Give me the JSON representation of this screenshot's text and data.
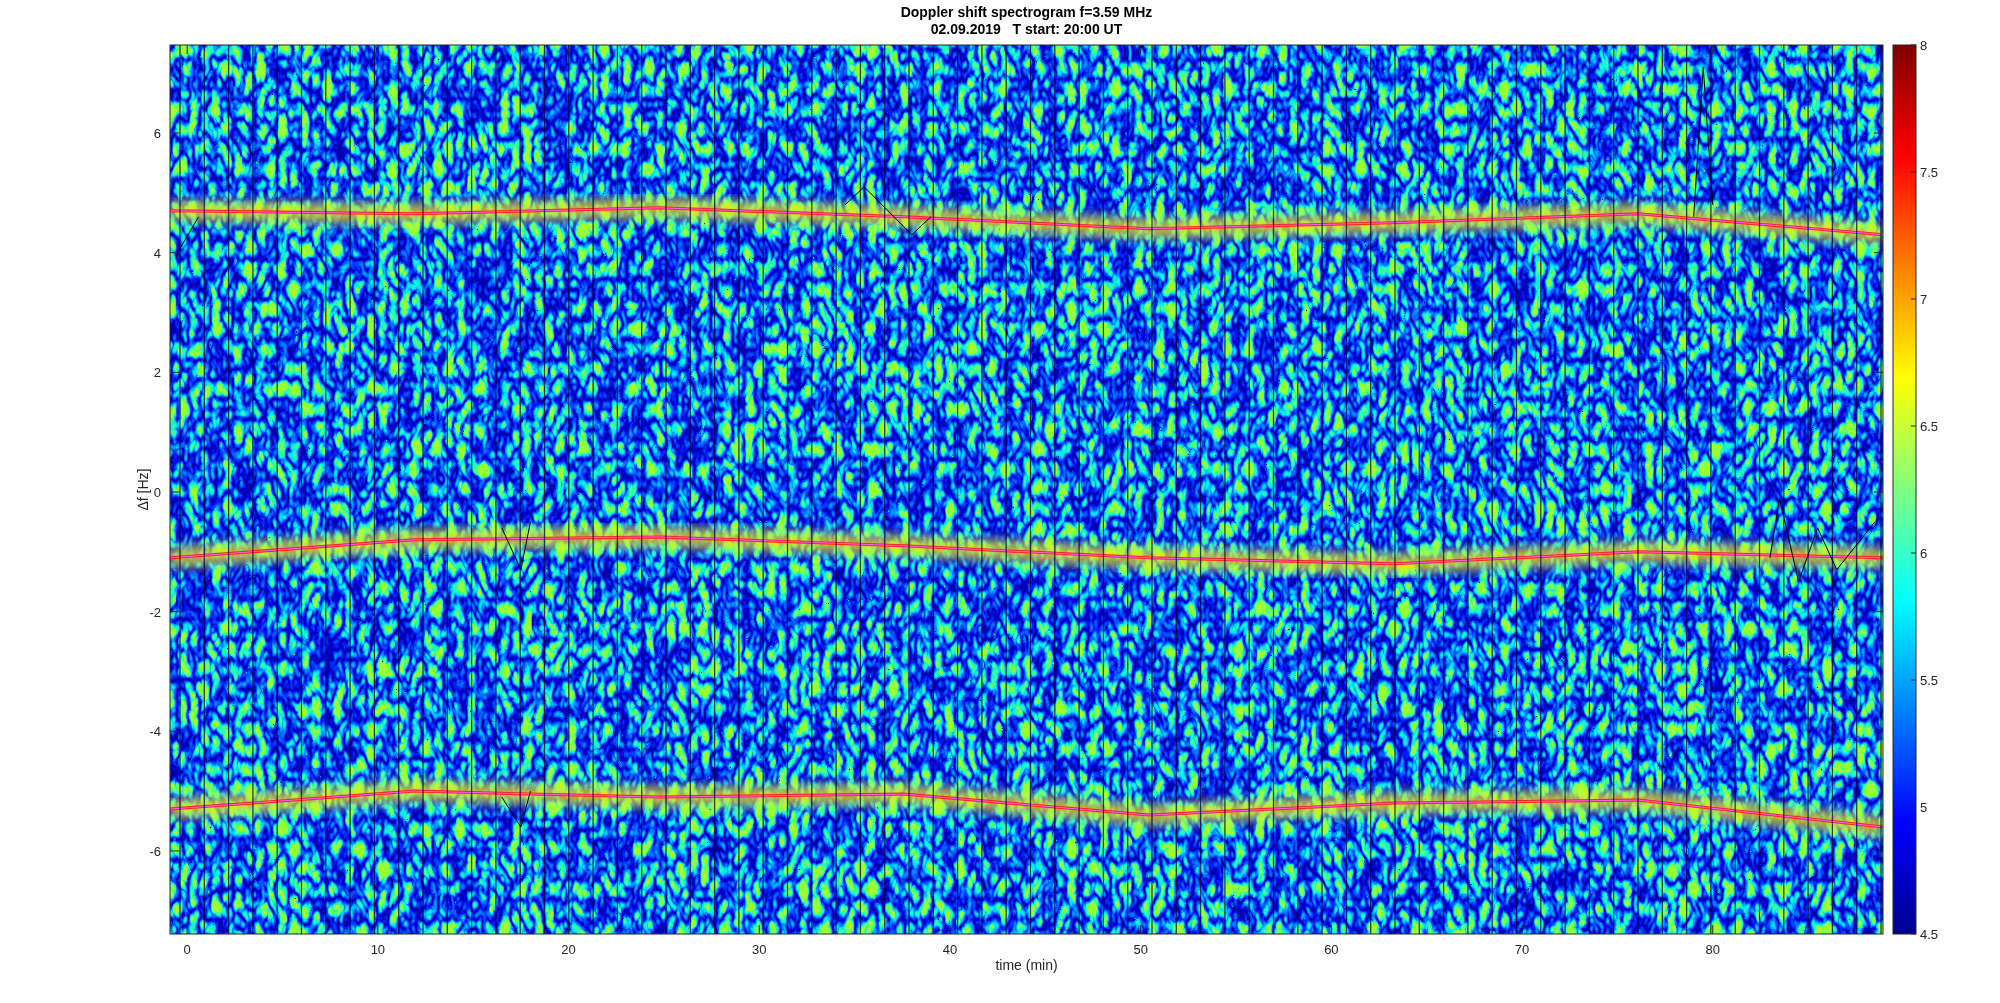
{
  "title": [
    "Doppler shift spectrogram f=3.59 MHz",
    "02.09.2019   T start: 20:00 UT"
  ],
  "x_axis": {
    "label": "time (min)",
    "ticks": [
      "0",
      "10",
      "20",
      "30",
      "40",
      "50",
      "60",
      "70",
      "80"
    ]
  },
  "y_axis": {
    "label": "Δf [Hz]",
    "ticks": [
      "6",
      "4",
      "2",
      "0",
      "-2",
      "-4",
      "-6"
    ]
  },
  "colorbar": {
    "ticks": [
      "8",
      "7.5",
      "7",
      "6.5",
      "6",
      "5.5",
      "5",
      "4.5"
    ]
  }
}
